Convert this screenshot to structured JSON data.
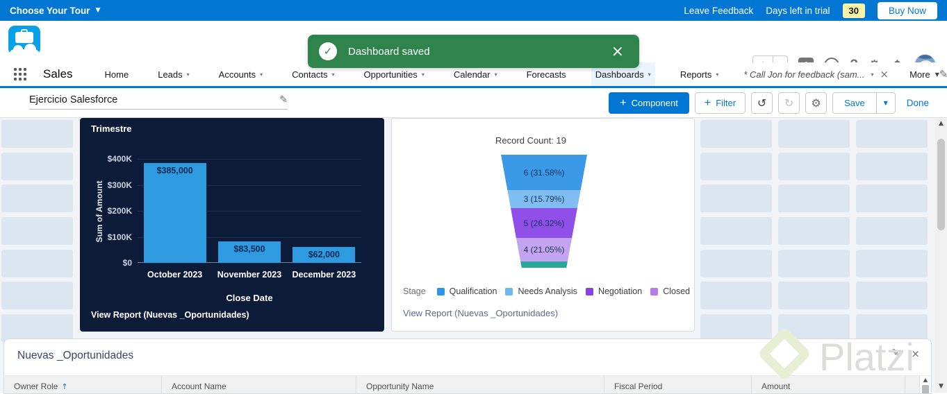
{
  "trial_bar": {
    "tour": "Choose Your Tour",
    "leave_feedback": "Leave Feedback",
    "days_left_label": "Days left in trial",
    "days_left_value": "30",
    "buy_now": "Buy Now"
  },
  "toast": {
    "message": "Dashboard saved"
  },
  "nav": {
    "app_name": "Sales",
    "items": [
      {
        "label": "Home",
        "chevron": false,
        "active": false
      },
      {
        "label": "Leads",
        "chevron": true,
        "active": false
      },
      {
        "label": "Accounts",
        "chevron": true,
        "active": false
      },
      {
        "label": "Contacts",
        "chevron": true,
        "active": false
      },
      {
        "label": "Opportunities",
        "chevron": true,
        "active": false
      },
      {
        "label": "Calendar",
        "chevron": true,
        "active": false
      },
      {
        "label": "Forecasts",
        "chevron": false,
        "active": false
      },
      {
        "label": "Dashboards",
        "chevron": true,
        "active": true
      },
      {
        "label": "Reports",
        "chevron": true,
        "active": false
      }
    ],
    "temp_tab": {
      "label": "* Call Jon for feedback (sam..."
    },
    "more_label": "More"
  },
  "toolbar": {
    "title": "Ejercicio Salesforce",
    "component_label": "Component",
    "filter_label": "Filter",
    "save_label": "Save",
    "done_label": "Done"
  },
  "chart_data": [
    {
      "type": "bar",
      "title": "Trimestre",
      "categories": [
        "October 2023",
        "November 2023",
        "December 2023"
      ],
      "values": [
        385000,
        83500,
        62000
      ],
      "value_labels": [
        "$385,000",
        "$83,500",
        "$62,000"
      ],
      "xlabel": "Close Date",
      "ylabel": "Sum of Amount",
      "ylim": [
        0,
        400000
      ],
      "yticks": [
        {
          "v": 400000,
          "label": "$400K"
        },
        {
          "v": 300000,
          "label": "$300K"
        },
        {
          "v": 200000,
          "label": "$200K"
        },
        {
          "v": 100000,
          "label": "$100K"
        },
        {
          "v": 0,
          "label": "$0"
        }
      ],
      "grid": true,
      "bar_color": "#2E9AE0",
      "background": "#0c1b38",
      "footer": "View Report (Nuevas _Oportunidades)"
    },
    {
      "type": "funnel",
      "title": "Record Count: 19",
      "total": 19,
      "segments": [
        {
          "label": "6 (31.58%)",
          "value": 6,
          "color": "#3B99E8"
        },
        {
          "label": "3 (15.79%)",
          "value": 3,
          "color": "#7FBDF2"
        },
        {
          "label": "5 (26.32%)",
          "value": 5,
          "color": "#8F4FE8"
        },
        {
          "label": "4 (21.05%)",
          "value": 4,
          "color": "#C4A4EE"
        },
        {
          "label": "",
          "value": 1,
          "color": "#29A79A"
        }
      ],
      "legend_title": "Stage",
      "legend_position": "bottom",
      "legend": [
        {
          "label": "Qualification",
          "color": "#2B96E8"
        },
        {
          "label": "Needs Analysis",
          "color": "#6CB9F0"
        },
        {
          "label": "Negotiation",
          "color": "#8B3FE8"
        },
        {
          "label": "Closed Won",
          "color": "#B77BEA"
        }
      ],
      "footer": "View Report (Nuevas _Oportunidades)"
    }
  ],
  "table": {
    "title": "Nuevas _Oportunidades",
    "columns": [
      {
        "label": "Owner Role",
        "sort": "↑"
      },
      {
        "label": "Account Name",
        "sort": ""
      },
      {
        "label": "Opportunity Name",
        "sort": ""
      },
      {
        "label": "Fiscal Period",
        "sort": ""
      },
      {
        "label": "Amount",
        "sort": ""
      }
    ]
  },
  "watermark": {
    "text": "Platzi"
  },
  "colors": {
    "brand_blue": "#0176d3",
    "success_green": "#2e844a",
    "trial_badge_yellow": "#fbf3a8",
    "canvas_tile": "#dce6f1",
    "chart_navy": "#0c1b38"
  },
  "icons": {
    "dropdown": "▼",
    "chevron_down": "▾",
    "star": "★",
    "plus": "+",
    "help": "?",
    "gear": "⚙",
    "undo": "↺",
    "redo": "↻",
    "pencil": "✎",
    "close": "×",
    "check": "✓",
    "scroll_up": "▲",
    "scroll_down": "▼"
  }
}
